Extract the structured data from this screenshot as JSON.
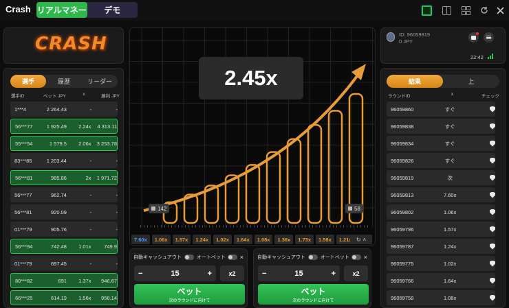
{
  "app": {
    "title": "Crash"
  },
  "mode_tabs": [
    {
      "label": "リアルマネー",
      "active": true
    },
    {
      "label": "デモ",
      "active": false
    }
  ],
  "logo": {
    "text": "CRASH"
  },
  "left_panel": {
    "tabs": [
      {
        "label": "選手",
        "active": true
      },
      {
        "label": "履歴",
        "active": false
      },
      {
        "label": "リーダー",
        "active": false
      }
    ],
    "headers": {
      "player": "選手ID",
      "bet": "ベット JPY",
      "mult": "x",
      "win": "勝利 JPY"
    },
    "rows": [
      {
        "player": "1***4",
        "bet": "2 264.43",
        "mult": "-",
        "win": "-",
        "won": false
      },
      {
        "player": "56***77",
        "bet": "1 925.49",
        "mult": "2.24x",
        "win": "4 313.11",
        "won": true
      },
      {
        "player": "55***54",
        "bet": "1 579.5",
        "mult": "2.06x",
        "win": "3 253.78",
        "won": true
      },
      {
        "player": "83***85",
        "bet": "1 203.44",
        "mult": "-",
        "win": "-",
        "won": false
      },
      {
        "player": "56***81",
        "bet": "985.86",
        "mult": "2x",
        "win": "1 971.72",
        "won": true
      },
      {
        "player": "56***77",
        "bet": "962.74",
        "mult": "-",
        "win": "-",
        "won": false
      },
      {
        "player": "56***81",
        "bet": "920.09",
        "mult": "-",
        "win": "-",
        "won": false
      },
      {
        "player": "01***79",
        "bet": "905.76",
        "mult": "-",
        "win": "-",
        "won": false
      },
      {
        "player": "56***94",
        "bet": "742.48",
        "mult": "1.01x",
        "win": "749.9",
        "won": true
      },
      {
        "player": "01***79",
        "bet": "697.45",
        "mult": "-",
        "win": "-",
        "won": false
      },
      {
        "player": "80***82",
        "bet": "691",
        "mult": "1.37x",
        "win": "946.67",
        "won": true
      },
      {
        "player": "66***25",
        "bet": "614.19",
        "mult": "1.56x",
        "win": "958.14",
        "won": true
      }
    ]
  },
  "game": {
    "multiplier": "2.45x",
    "players_count": "142",
    "winners_count": "58",
    "bars": [
      0.16,
      0.22,
      0.29,
      0.37,
      0.45,
      0.55,
      0.65,
      0.76,
      0.87,
      1.0
    ],
    "history": [
      "7.60x",
      "1.06x",
      "1.57x",
      "1.24x",
      "1.02x",
      "1.64x",
      "1.08x",
      "1.36x",
      "1.73x",
      "1.58x",
      "1.21x"
    ]
  },
  "bet_panels": [
    {
      "auto_cashout_label": "自動キャッシュアウト",
      "auto_bet_label": "オートベット",
      "amount": "15",
      "minus": "−",
      "plus": "+",
      "double_label": "x2",
      "bet_label": "ベット",
      "bet_sub": "次のラウンドに向けて",
      "close": "×"
    },
    {
      "auto_cashout_label": "自動キャッシュアウト",
      "auto_bet_label": "オートベット",
      "amount": "15",
      "minus": "−",
      "plus": "+",
      "double_label": "x2",
      "bet_label": "ベット",
      "bet_sub": "次のラウンドに向けて",
      "close": "×"
    }
  ],
  "account": {
    "id_label": "ID: 96059819",
    "balance": "0 JPY",
    "time": "22:42"
  },
  "right_panel": {
    "tabs": [
      {
        "label": "結果",
        "active": true
      },
      {
        "label": "上",
        "active": false
      }
    ],
    "headers": {
      "round": "ラウンドID",
      "mult": "x",
      "check": "チェック"
    },
    "rows": [
      {
        "round": "96059860",
        "mult": "すぐ"
      },
      {
        "round": "96059838",
        "mult": "すぐ"
      },
      {
        "round": "96059834",
        "mult": "すぐ"
      },
      {
        "round": "96059826",
        "mult": "すぐ"
      },
      {
        "round": "96059819",
        "mult": "次"
      },
      {
        "round": "96059813",
        "mult": "7.60x"
      },
      {
        "round": "96059802",
        "mult": "1.06x"
      },
      {
        "round": "96059796",
        "mult": "1.57x"
      },
      {
        "round": "96059787",
        "mult": "1.24x"
      },
      {
        "round": "96059775",
        "mult": "1.02x"
      },
      {
        "round": "96059766",
        "mult": "1.64x"
      },
      {
        "round": "96059758",
        "mult": "1.08x"
      }
    ]
  }
}
